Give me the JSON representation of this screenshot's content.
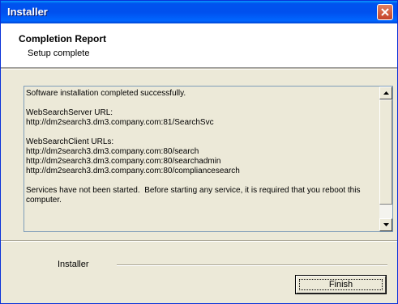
{
  "window": {
    "title": "Installer"
  },
  "header": {
    "title": "Completion Report",
    "subtitle": "Setup complete"
  },
  "report": {
    "lines": [
      "Software installation completed successfully.",
      "",
      "WebSearchServer URL:",
      "http://dm2search3.dm3.company.com:81/SearchSvc",
      "",
      "WebSearchClient URLs:",
      "http://dm2search3.dm3.company.com:80/search",
      "http://dm2search3.dm3.company.com:80/searchadmin",
      "http://dm2search3.dm3.company.com:80/compliancesearch",
      "",
      "Services have not been started.  Before starting any service, it is required that you reboot this",
      "computer."
    ]
  },
  "footer": {
    "brand_label": "Installer",
    "finish_label": "Finish"
  },
  "icons": {
    "close": "close-icon",
    "scroll_up": "arrow-up-icon",
    "scroll_down": "arrow-down-icon"
  },
  "colors": {
    "titlebar": "#0053ee",
    "close_button": "#c4432a",
    "dialog_bg": "#ece9d8"
  }
}
